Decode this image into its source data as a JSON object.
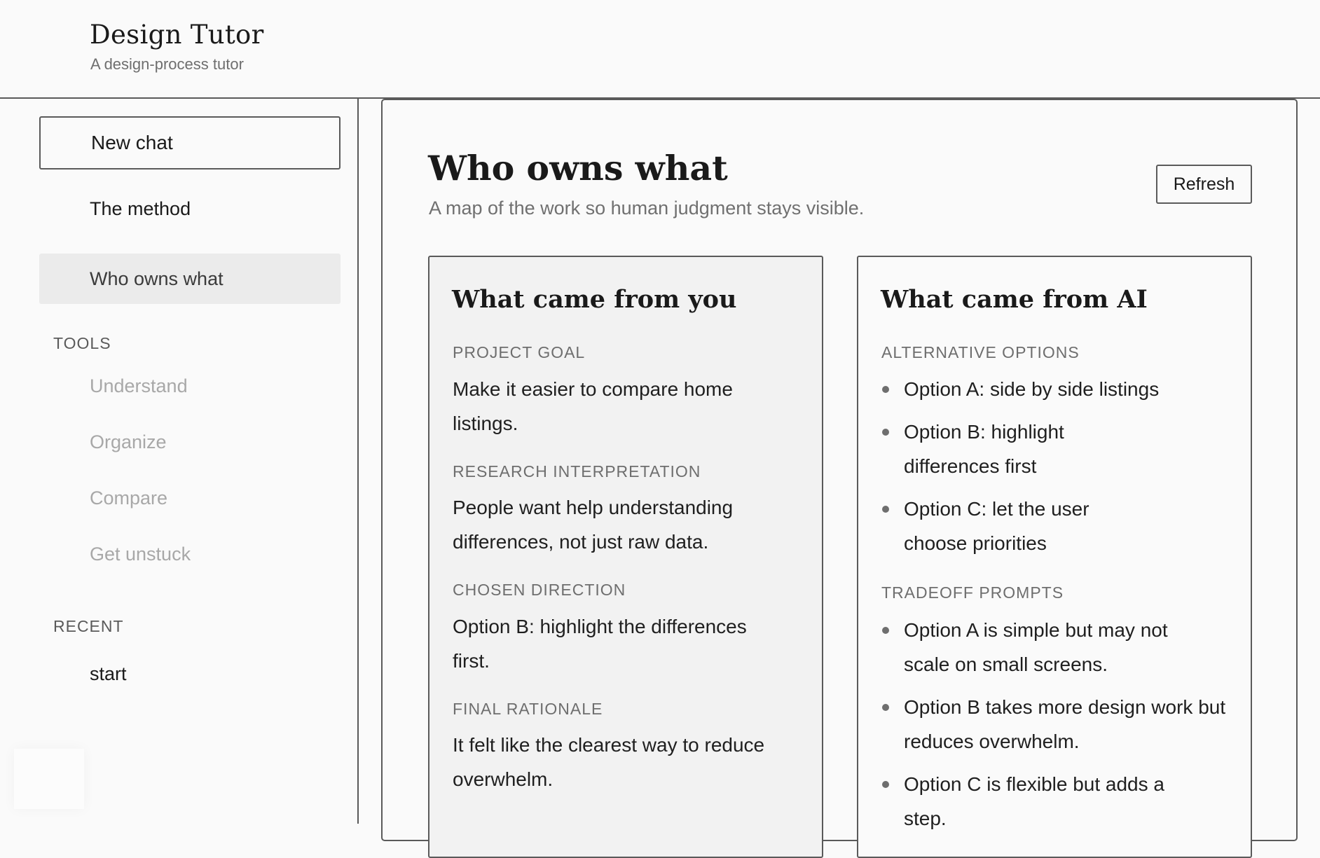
{
  "header": {
    "title": "Design Tutor",
    "subtitle": "A design-process tutor"
  },
  "sidebar": {
    "new_chat_label": "New chat",
    "nav_items": [
      {
        "label": "The method",
        "active": false
      },
      {
        "label": "Who owns what",
        "active": true
      }
    ],
    "tools_label": "TOOLS",
    "tools": [
      "Understand",
      "Organize",
      "Compare",
      "Get unstuck"
    ],
    "recent_label": "RECENT",
    "recent": [
      "start"
    ]
  },
  "main": {
    "title": "Who owns what",
    "description": "A map of the work so human judgment stays visible.",
    "refresh_label": "Refresh",
    "you_card": {
      "title": "What came from you",
      "fields": [
        {
          "label": "PROJECT GOAL",
          "value": "Make it easier to compare home listings."
        },
        {
          "label": "RESEARCH INTERPRETATION",
          "value": "People want help understanding differences, not just raw data."
        },
        {
          "label": "CHOSEN DIRECTION",
          "value": "Option B: highlight the differences first."
        },
        {
          "label": "FINAL RATIONALE",
          "value": "It felt like the clearest way to reduce overwhelm."
        }
      ]
    },
    "ai_card": {
      "title": "What came from AI",
      "sections": [
        {
          "label": "ALTERNATIVE OPTIONS",
          "items": [
            "Option A: side by side listings",
            "Option B: highlight differences first",
            "Option C: let the user choose priorities"
          ]
        },
        {
          "label": "TRADEOFF PROMPTS",
          "items": [
            "Option A is simple but may not scale on small screens.",
            "Option B takes more design work but reduces overwhelm.",
            "Option C is flexible but adds a step."
          ]
        }
      ]
    }
  }
}
